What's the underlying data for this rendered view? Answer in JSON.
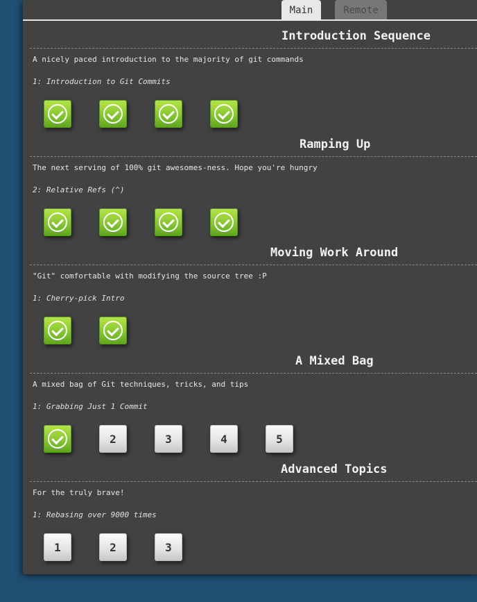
{
  "tabs": {
    "main": "Main",
    "remote": "Remote"
  },
  "sequences": [
    {
      "title": "Introduction Sequence",
      "description": "A nicely paced introduction to the majority of git commands",
      "current_level": "1: Introduction to Git Commits",
      "levels": [
        {
          "label": "1",
          "state": "done"
        },
        {
          "label": "2",
          "state": "done"
        },
        {
          "label": "3",
          "state": "done"
        },
        {
          "label": "4",
          "state": "done"
        }
      ]
    },
    {
      "title": "Ramping Up",
      "description": "The next serving of 100% git awesomes-ness. Hope you're hungry",
      "current_level": "2: Relative Refs (^)",
      "levels": [
        {
          "label": "1",
          "state": "done"
        },
        {
          "label": "2",
          "state": "done"
        },
        {
          "label": "3",
          "state": "done"
        },
        {
          "label": "4",
          "state": "done"
        }
      ]
    },
    {
      "title": "Moving Work Around",
      "description": "\"Git\" comfortable with modifying the source tree :P",
      "current_level": "1: Cherry-pick Intro",
      "levels": [
        {
          "label": "1",
          "state": "done"
        },
        {
          "label": "2",
          "state": "done"
        }
      ]
    },
    {
      "title": "A Mixed Bag",
      "description": "A mixed bag of Git techniques, tricks, and tips",
      "current_level": "1: Grabbing Just 1 Commit",
      "levels": [
        {
          "label": "1",
          "state": "done"
        },
        {
          "label": "2",
          "state": "todo"
        },
        {
          "label": "3",
          "state": "todo"
        },
        {
          "label": "4",
          "state": "todo"
        },
        {
          "label": "5",
          "state": "todo"
        }
      ]
    },
    {
      "title": "Advanced Topics",
      "description": "For the truly brave!",
      "current_level": "1: Rebasing over 9000 times",
      "levels": [
        {
          "label": "1",
          "state": "todo"
        },
        {
          "label": "2",
          "state": "todo"
        },
        {
          "label": "3",
          "state": "todo"
        }
      ]
    }
  ],
  "colors": {
    "background": "#1f4f73",
    "panel": "#424242",
    "level_done": "#86c733",
    "level_todo": "#e2e2e2"
  },
  "icons": {
    "level_done": "check-circle-icon"
  }
}
